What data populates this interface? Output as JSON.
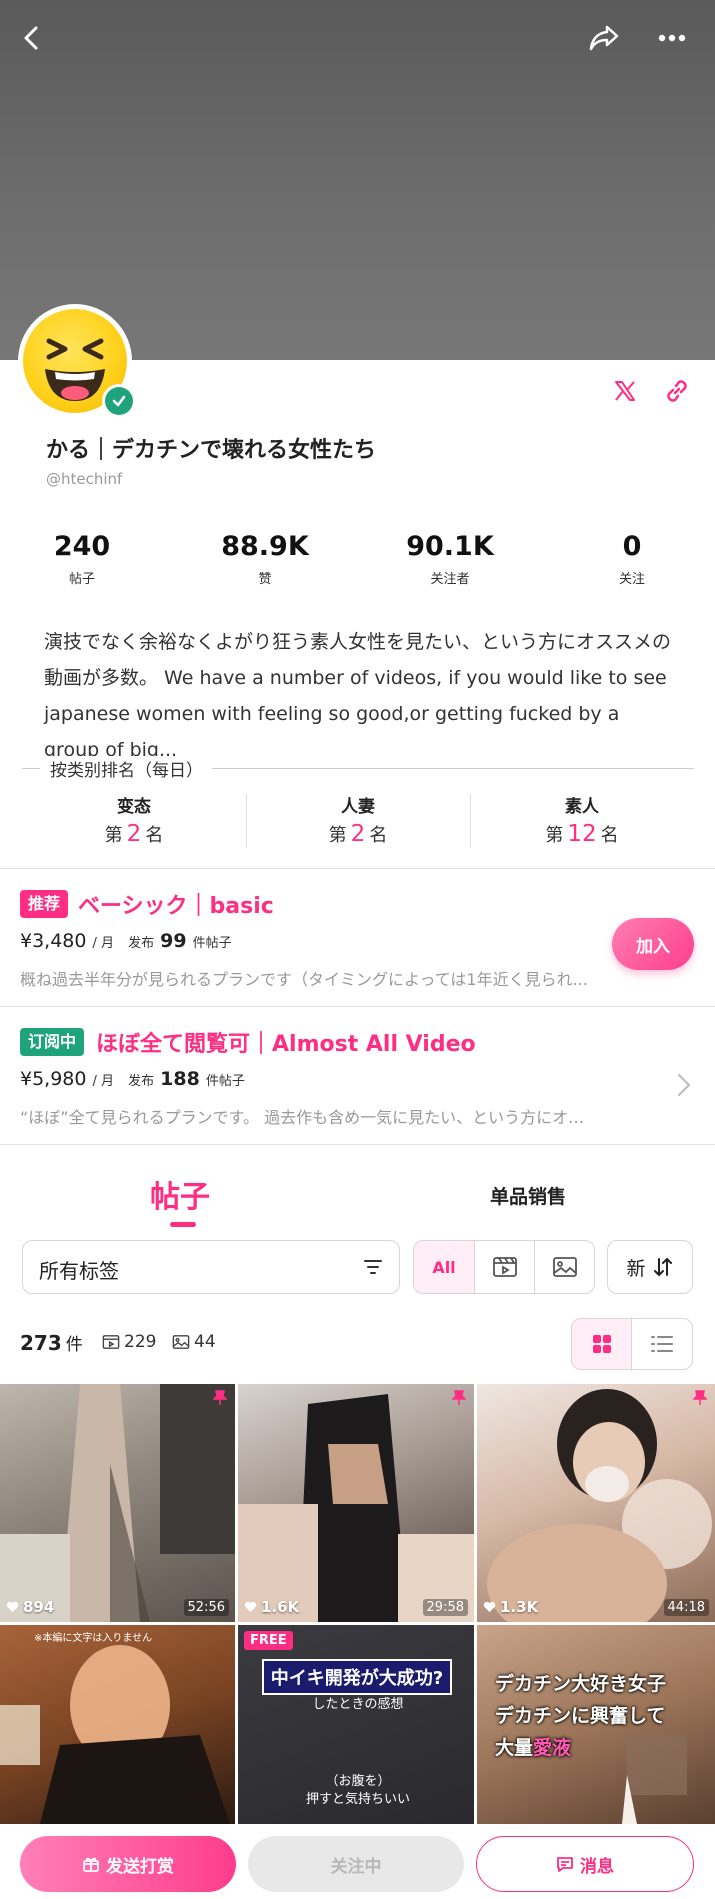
{
  "profile": {
    "name": "かる｜デカチンで壊れる女性たち",
    "handle": "@htechinf",
    "bio": "演技でなく余裕なくよがり狂う素人女性を見たい、という方にオススメの動画が多数。 We have a number of videos, if you would like to see japanese women with feeling so good,or getting fucked by a group of big..."
  },
  "stats": [
    {
      "value": "240",
      "label": "帖子"
    },
    {
      "value": "88.9K",
      "label": "赞"
    },
    {
      "value": "90.1K",
      "label": "关注者"
    },
    {
      "value": "0",
      "label": "关注"
    }
  ],
  "ranking": {
    "title": "按类别排名（每日）",
    "prefix": "第",
    "suffix": "名",
    "items": [
      {
        "category": "变态",
        "rank": "2"
      },
      {
        "category": "人妻",
        "rank": "2"
      },
      {
        "category": "素人",
        "rank": "12"
      }
    ]
  },
  "plans": [
    {
      "badge": "推荐",
      "badge_color": "#ff2e83",
      "title": "ベーシック｜basic",
      "price": "¥3,480",
      "unit": "/ 月",
      "published_label": "发布",
      "post_count": "99",
      "post_unit": "件帖子",
      "description": "概ね過去半年分が見られるプランです（タイミングによっては1年近く見られ...",
      "action": "加入"
    },
    {
      "badge": "订阅中",
      "badge_color": "#1fa37a",
      "title": "ほぼ全て閲覧可｜Almost All Video",
      "price": "¥5,980",
      "unit": "/ 月",
      "published_label": "发布",
      "post_count": "188",
      "post_unit": "件帖子",
      "description": "“ほぼ”全て見られるプランです。 過去作も含め一気に見たい、という方にオススメで..."
    }
  ],
  "tabs": {
    "posts": "帖子",
    "single_sale": "单品销售"
  },
  "filters": {
    "tag_select": "所有标签",
    "type_all": "All",
    "sort": "新"
  },
  "counts": {
    "total": "273",
    "total_unit": "件",
    "videos": "229",
    "images": "44"
  },
  "thumbnails": [
    {
      "likes": "894",
      "duration": "52:56",
      "pinned": true
    },
    {
      "likes": "1.6K",
      "duration": "29:58",
      "pinned": true
    },
    {
      "likes": "1.3K",
      "duration": "44:18",
      "pinned": true
    },
    {
      "note": "※本編に文字は入りません"
    },
    {
      "free": "FREE",
      "caption": "中イキ開発が大成功?",
      "caption_sub": "したときの感想",
      "caption_bottom_1": "（お腹を）",
      "caption_bottom_2": "押すと気持ちいい"
    },
    {
      "line1": "デカチン大好き女子",
      "line2": "デカチンに興奮して",
      "line3_a": "大量",
      "line3_b": "愛液"
    }
  ],
  "bottom_bar": {
    "tip": "发送打赏",
    "follow": "关注中",
    "message": "消息"
  },
  "colors": {
    "accent": "#ff2e83",
    "verified": "#1fa37a"
  }
}
